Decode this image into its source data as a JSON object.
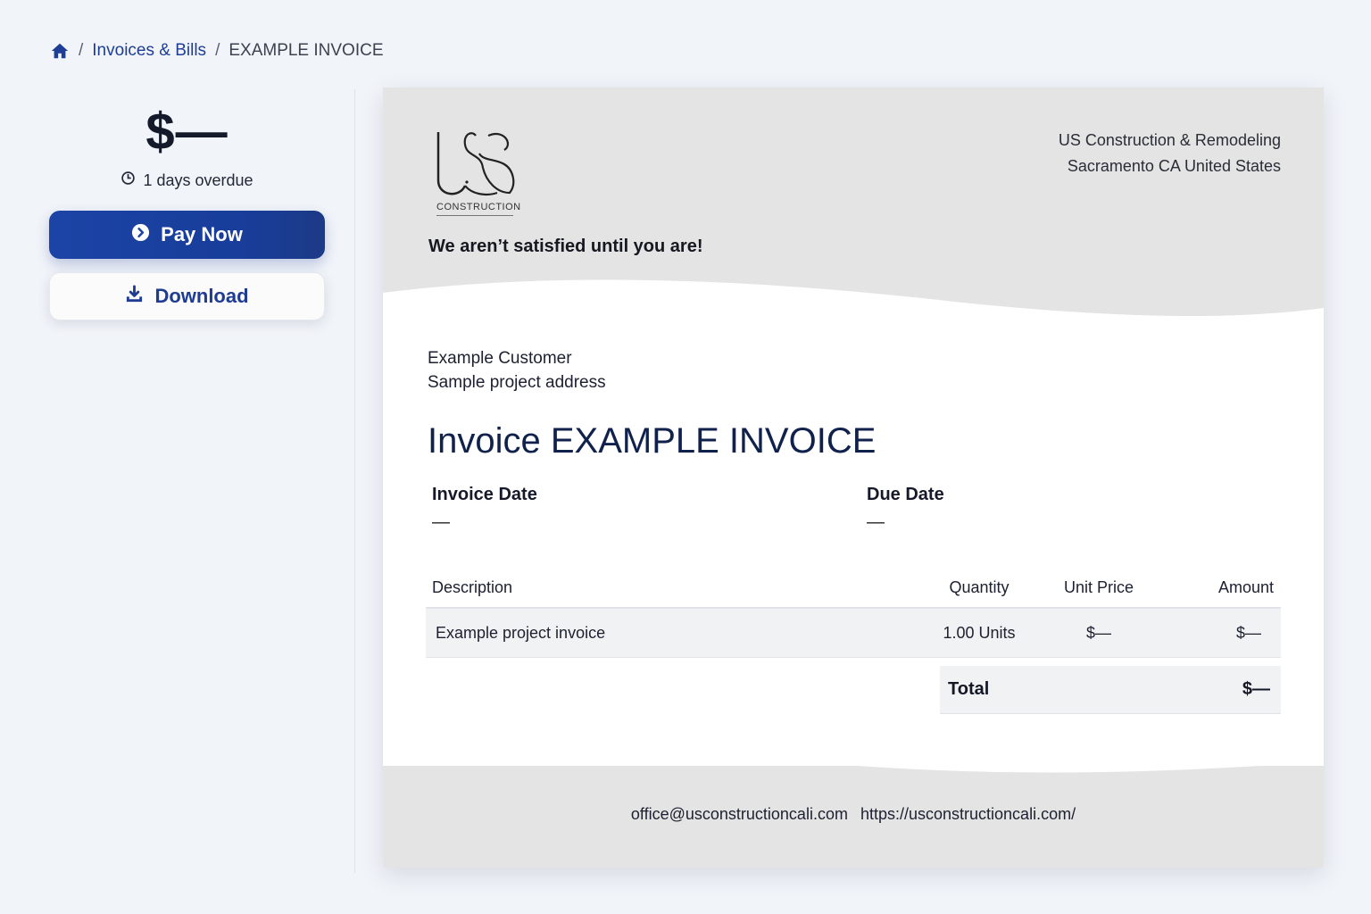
{
  "breadcrumb": {
    "home_icon": "home-icon",
    "separator": "/",
    "link": "Invoices & Bills",
    "current": "EXAMPLE INVOICE"
  },
  "summary": {
    "amount": "$—",
    "overdue_text": "1 days overdue",
    "clock_icon": "clock-icon"
  },
  "actions": {
    "pay_label": "Pay Now",
    "pay_icon": "arrow-circle-right-icon",
    "download_label": "Download",
    "download_icon": "download-icon"
  },
  "invoice": {
    "logo_text": "CONSTRUCTION",
    "tagline": "We aren’t satisfied until you are!",
    "company_name": "US Construction & Remodeling",
    "company_location": "Sacramento CA United States",
    "customer_name": "Example Customer",
    "customer_address": "Sample project address",
    "title": "Invoice EXAMPLE INVOICE",
    "invoice_date_label": "Invoice Date",
    "invoice_date_value": "—",
    "due_date_label": "Due Date",
    "due_date_value": "—",
    "columns": {
      "description": "Description",
      "quantity": "Quantity",
      "unit_price": "Unit Price",
      "amount": "Amount"
    },
    "items": [
      {
        "description": "Example project invoice",
        "quantity": "1.00 Units",
        "unit_price": "$—",
        "amount": "$—"
      }
    ],
    "total_label": "Total",
    "total_value": "$—",
    "footer_email": "office@usconstructioncali.com",
    "footer_url": "https://usconstructioncali.com/"
  },
  "colors": {
    "accent": "#1c44a6",
    "link": "#1e3e96",
    "title": "#10224c",
    "doc_band": "#e4e4e4",
    "page_bg": "#f1f4f9"
  }
}
